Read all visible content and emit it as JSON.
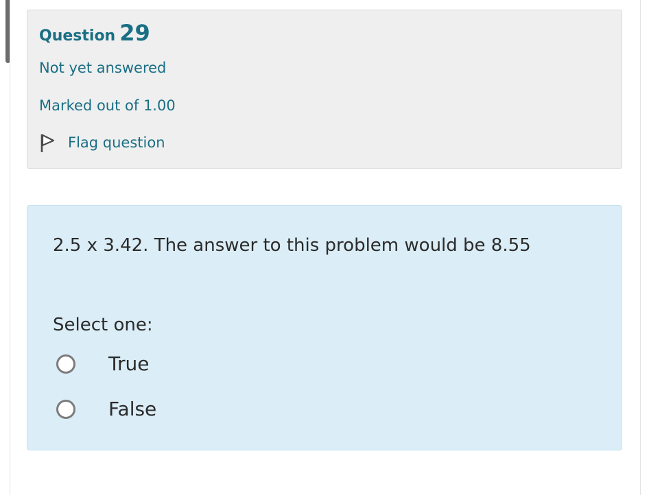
{
  "question_info": {
    "title_word": "Question",
    "number": "29",
    "state": "Not yet answered",
    "grade": "Marked out of 1.00",
    "flag_label": "Flag question"
  },
  "formulation": {
    "question_text": "2.5 x 3.42. The answer to this problem would be 8.55",
    "prompt": "Select one:",
    "options": [
      {
        "label": "True",
        "selected": false
      },
      {
        "label": "False",
        "selected": false
      }
    ]
  },
  "colors": {
    "link": "#1a6f84",
    "info_background": "#efefef",
    "formulation_background": "#dbedf6"
  }
}
